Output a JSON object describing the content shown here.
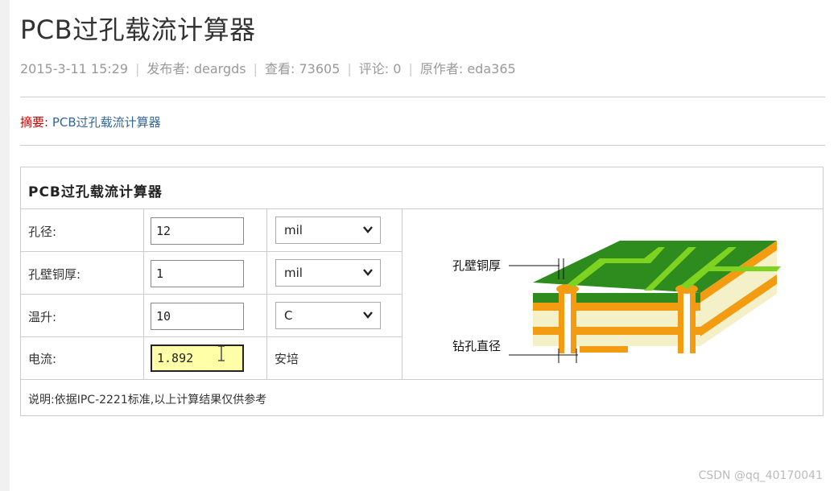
{
  "article": {
    "title": "PCB过孔载流计算器",
    "meta": {
      "date": "2015-3-11 15:29",
      "publisher": "发布者: deargds",
      "views": "查看: 73605",
      "comments": "评论: 0",
      "author": "原作者: eda365"
    },
    "summary_key": "摘要:",
    "summary_value": "PCB过孔载流计算器"
  },
  "calculator": {
    "title": "PCB过孔载流计算器",
    "rows": [
      {
        "label": "孔径:",
        "value": "12",
        "unit": "mil",
        "unit_type": "select"
      },
      {
        "label": "孔壁铜厚:",
        "value": "1",
        "unit": "mil",
        "unit_type": "select"
      },
      {
        "label": "温升:",
        "value": "10",
        "unit": "C",
        "unit_type": "select"
      },
      {
        "label": "电流:",
        "value": "1.892",
        "unit": "安培",
        "unit_type": "text"
      }
    ],
    "note": "说明:依据IPC-2221标准,以上计算结果仅供参考",
    "diagram": {
      "label_wall": "孔壁铜厚",
      "label_drill": "钻孔直径"
    }
  },
  "colors": {
    "board_green": "#2e8b1e",
    "trace_green": "#7ed321",
    "copper_orange": "#f39c12",
    "substrate": "#f4f1c8",
    "result_bg": "#ffffa8",
    "summary_key": "#cc0000",
    "summary_value": "#336699"
  },
  "watermark": "CSDN @qq_40170041"
}
